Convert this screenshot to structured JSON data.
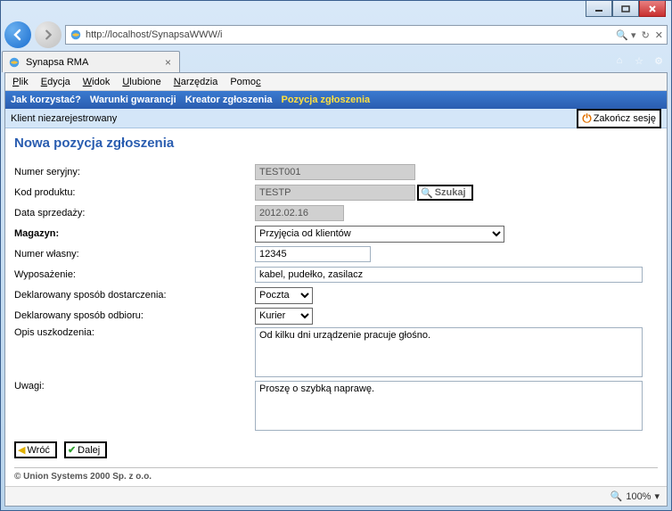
{
  "browser": {
    "url": "http://localhost/SynapsaWWW/i",
    "search_hint": "🔍 ▾",
    "tab_title": "Synapsa RMA"
  },
  "menubar": {
    "file": "Plik",
    "edit": "Edycja",
    "view": "Widok",
    "fav": "Ulubione",
    "tools": "Narzędzia",
    "help": "Pomoc"
  },
  "bluebar": {
    "howto": "Jak korzystać?",
    "warranty": "Warunki gwarancji",
    "wizard": "Kreator zgłoszenia",
    "position": "Pozycja zgłoszenia"
  },
  "lightbar": {
    "client": "Klient niezarejestrowany",
    "end_session": "Zakończ sesję"
  },
  "page": {
    "title": "Nowa pozycja zgłoszenia",
    "labels": {
      "serial": "Numer seryjny:",
      "product_code": "Kod produktu:",
      "sale_date": "Data sprzedaży:",
      "warehouse": "Magazyn:",
      "own_num": "Numer własny:",
      "equipment": "Wyposażenie:",
      "delivery": "Deklarowany sposób dostarczenia:",
      "pickup": "Deklarowany sposób odbioru:",
      "damage": "Opis uszkodzenia:",
      "notes": "Uwagi:"
    },
    "values": {
      "serial": "TEST001",
      "product_code": "TESTP",
      "sale_date": "2012.02.16",
      "warehouse": "Przyjęcia od klientów",
      "own_num": "12345",
      "equipment": "kabel, pudełko, zasilacz",
      "delivery": "Poczta",
      "pickup": "Kurier",
      "damage": "Od kilku dni urządzenie pracuje głośno.",
      "notes": "Proszę o szybką naprawę."
    },
    "buttons": {
      "search": "Szukaj",
      "back": "Wróć",
      "next": "Dalej"
    }
  },
  "footer": {
    "copyright": "© Union Systems 2000 Sp. z o.o."
  },
  "statusbar": {
    "zoom": "100%"
  }
}
